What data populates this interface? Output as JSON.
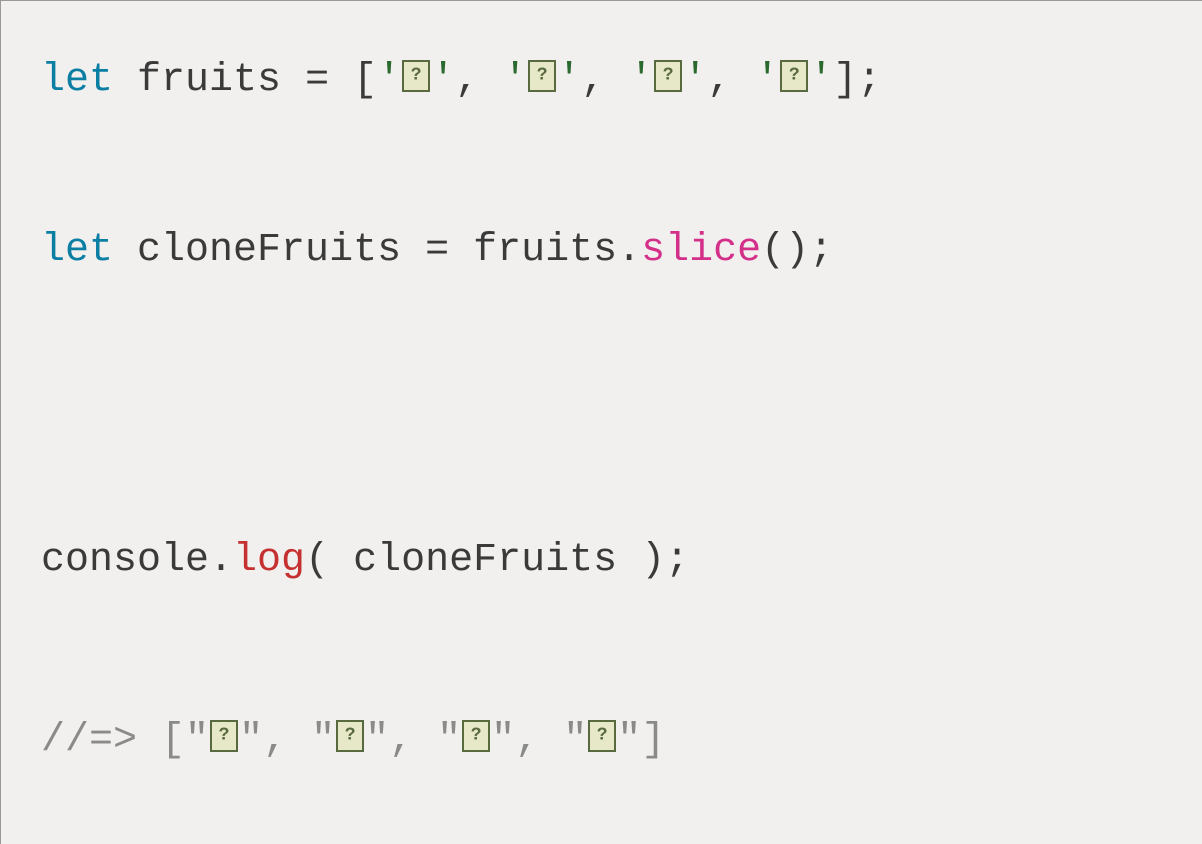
{
  "code": {
    "line1": {
      "kw": "let",
      "sp1": " ",
      "var": "fruits ",
      "eq": "= ",
      "lb": "[",
      "q": "'",
      "comma": ", ",
      "rb": "];"
    },
    "line2": {
      "kw": "let",
      "sp1": " ",
      "var": "cloneFruits ",
      "eq": "= ",
      "obj": "fruits",
      "dot": ".",
      "method": "slice",
      "paren": "();"
    },
    "line3": {
      "obj": "console",
      "dot": ".",
      "method": "log",
      "open": "( ",
      "arg": "cloneFruits ",
      "close": ");"
    },
    "line4": {
      "prefix": "//=> ",
      "lb": "[",
      "q": "\"",
      "comma": ", ",
      "rb": "]"
    }
  }
}
